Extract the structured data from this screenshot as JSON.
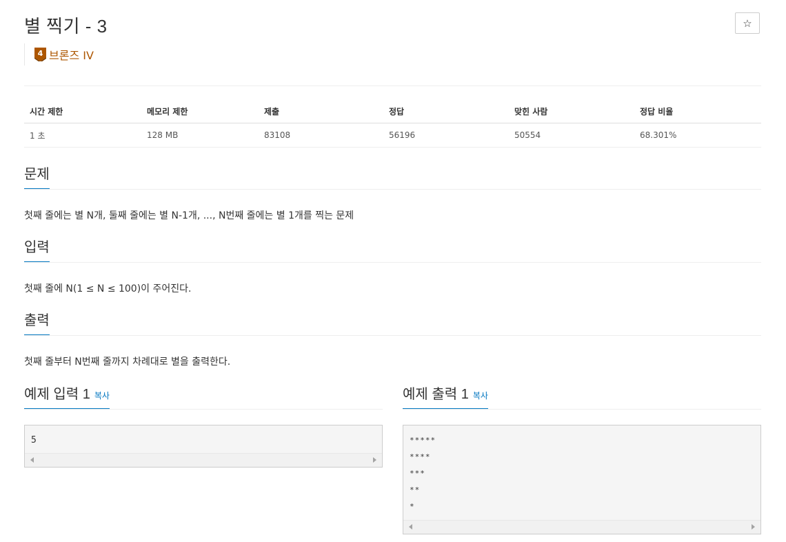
{
  "problem": {
    "title": "별 찍기 - 3",
    "tier": {
      "level": "4",
      "label": "브론즈 IV",
      "color": "#ad5600"
    }
  },
  "star_button": {
    "label": "☆"
  },
  "info_table": {
    "headers": [
      "시간 제한",
      "메모리 제한",
      "제출",
      "정답",
      "맞힌 사람",
      "정답 비율"
    ],
    "values": [
      "1 초",
      "128 MB",
      "83108",
      "56196",
      "50554",
      "68.301%"
    ]
  },
  "sections": {
    "problem": {
      "title": "문제",
      "text": "첫째 줄에는 별 N개, 둘째 줄에는 별 N-1개, ..., N번째 줄에는 별 1개를 찍는 문제"
    },
    "input": {
      "title": "입력",
      "text": "첫째 줄에 N(1 ≤ N ≤ 100)이 주어진다."
    },
    "output": {
      "title": "출력",
      "text": "첫째 줄부터 N번째 줄까지 차례대로 별을 출력한다."
    }
  },
  "samples": {
    "input": {
      "title": "예제 입력 1",
      "copy": "복사",
      "content": "5"
    },
    "output": {
      "title": "예제 출력 1",
      "copy": "복사",
      "lines": [
        "*****",
        "****",
        "***",
        "**",
        "*"
      ]
    }
  }
}
